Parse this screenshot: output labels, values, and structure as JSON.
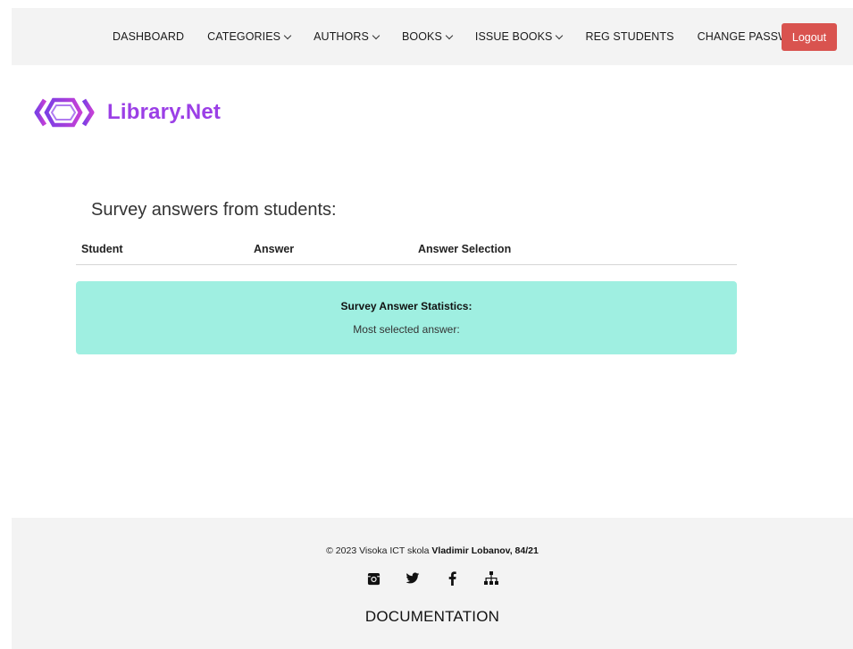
{
  "nav": {
    "items": [
      {
        "label": "DASHBOARD",
        "dropdown": false
      },
      {
        "label": "CATEGORIES",
        "dropdown": true
      },
      {
        "label": "AUTHORS",
        "dropdown": true
      },
      {
        "label": "BOOKS",
        "dropdown": true
      },
      {
        "label": "ISSUE BOOKS",
        "dropdown": true
      },
      {
        "label": "REG STUDENTS",
        "dropdown": false
      },
      {
        "label": "CHANGE PASSWORD",
        "dropdown": false
      }
    ],
    "logout_label": "Logout"
  },
  "logo": {
    "text": "Library.Net"
  },
  "survey": {
    "title": "Survey answers from students:",
    "columns": [
      "Student",
      "Answer",
      "Answer Selection"
    ],
    "rows": []
  },
  "stats": {
    "title": "Survey Answer Statistics:",
    "most_selected_label": "Most selected answer:"
  },
  "footer": {
    "copyright_prefix": "© 2023 Visoka ICT skola",
    "copyright_author": "Vladimir Lobanov, 84/21",
    "social_icons": [
      "instagram-icon",
      "twitter-icon",
      "facebook-icon",
      "sitemap-icon"
    ],
    "documentation_label": "DOCUMENTATION"
  },
  "colors": {
    "nav_bg": "#f3f3f3",
    "logout": "#d9534f",
    "logo": "#9b3fe6",
    "stats_bg": "#9fefe1"
  }
}
